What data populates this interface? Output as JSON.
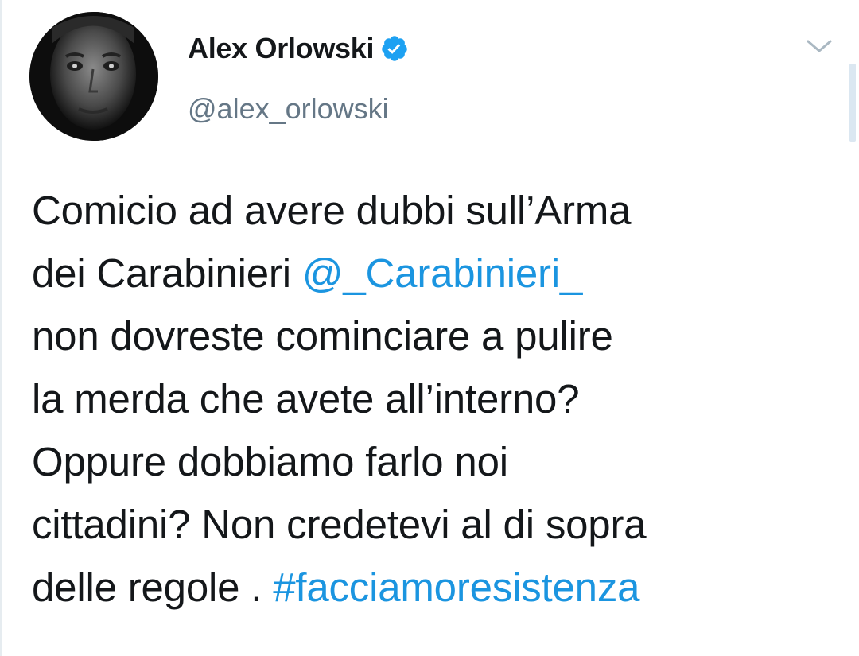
{
  "author": {
    "display_name": "Alex Orlowski",
    "handle": "@alex_orlowski",
    "verified": true
  },
  "tweet": {
    "line1": "Comicio ad avere dubbi sull’Arma",
    "line2_text": "dei Carabinieri ",
    "mention": "@_Carabinieri_",
    "line3": "non dovreste cominciare a pulire",
    "line4": "la merda che avete all’interno?",
    "line5": "Oppure dobbiamo farlo noi",
    "line6": "cittadini? Non credetevi al di sopra",
    "line7_text": "delle regole . ",
    "hashtag": "#facciamoresistenza"
  },
  "icons": {
    "avatar": "profile-photo",
    "verified": "verified-badge-icon",
    "menu": "chevron-down-icon"
  },
  "colors": {
    "link": "#1b95e0",
    "verified": "#1da1f2",
    "secondary_text": "#657786",
    "primary_text": "#14171a"
  }
}
